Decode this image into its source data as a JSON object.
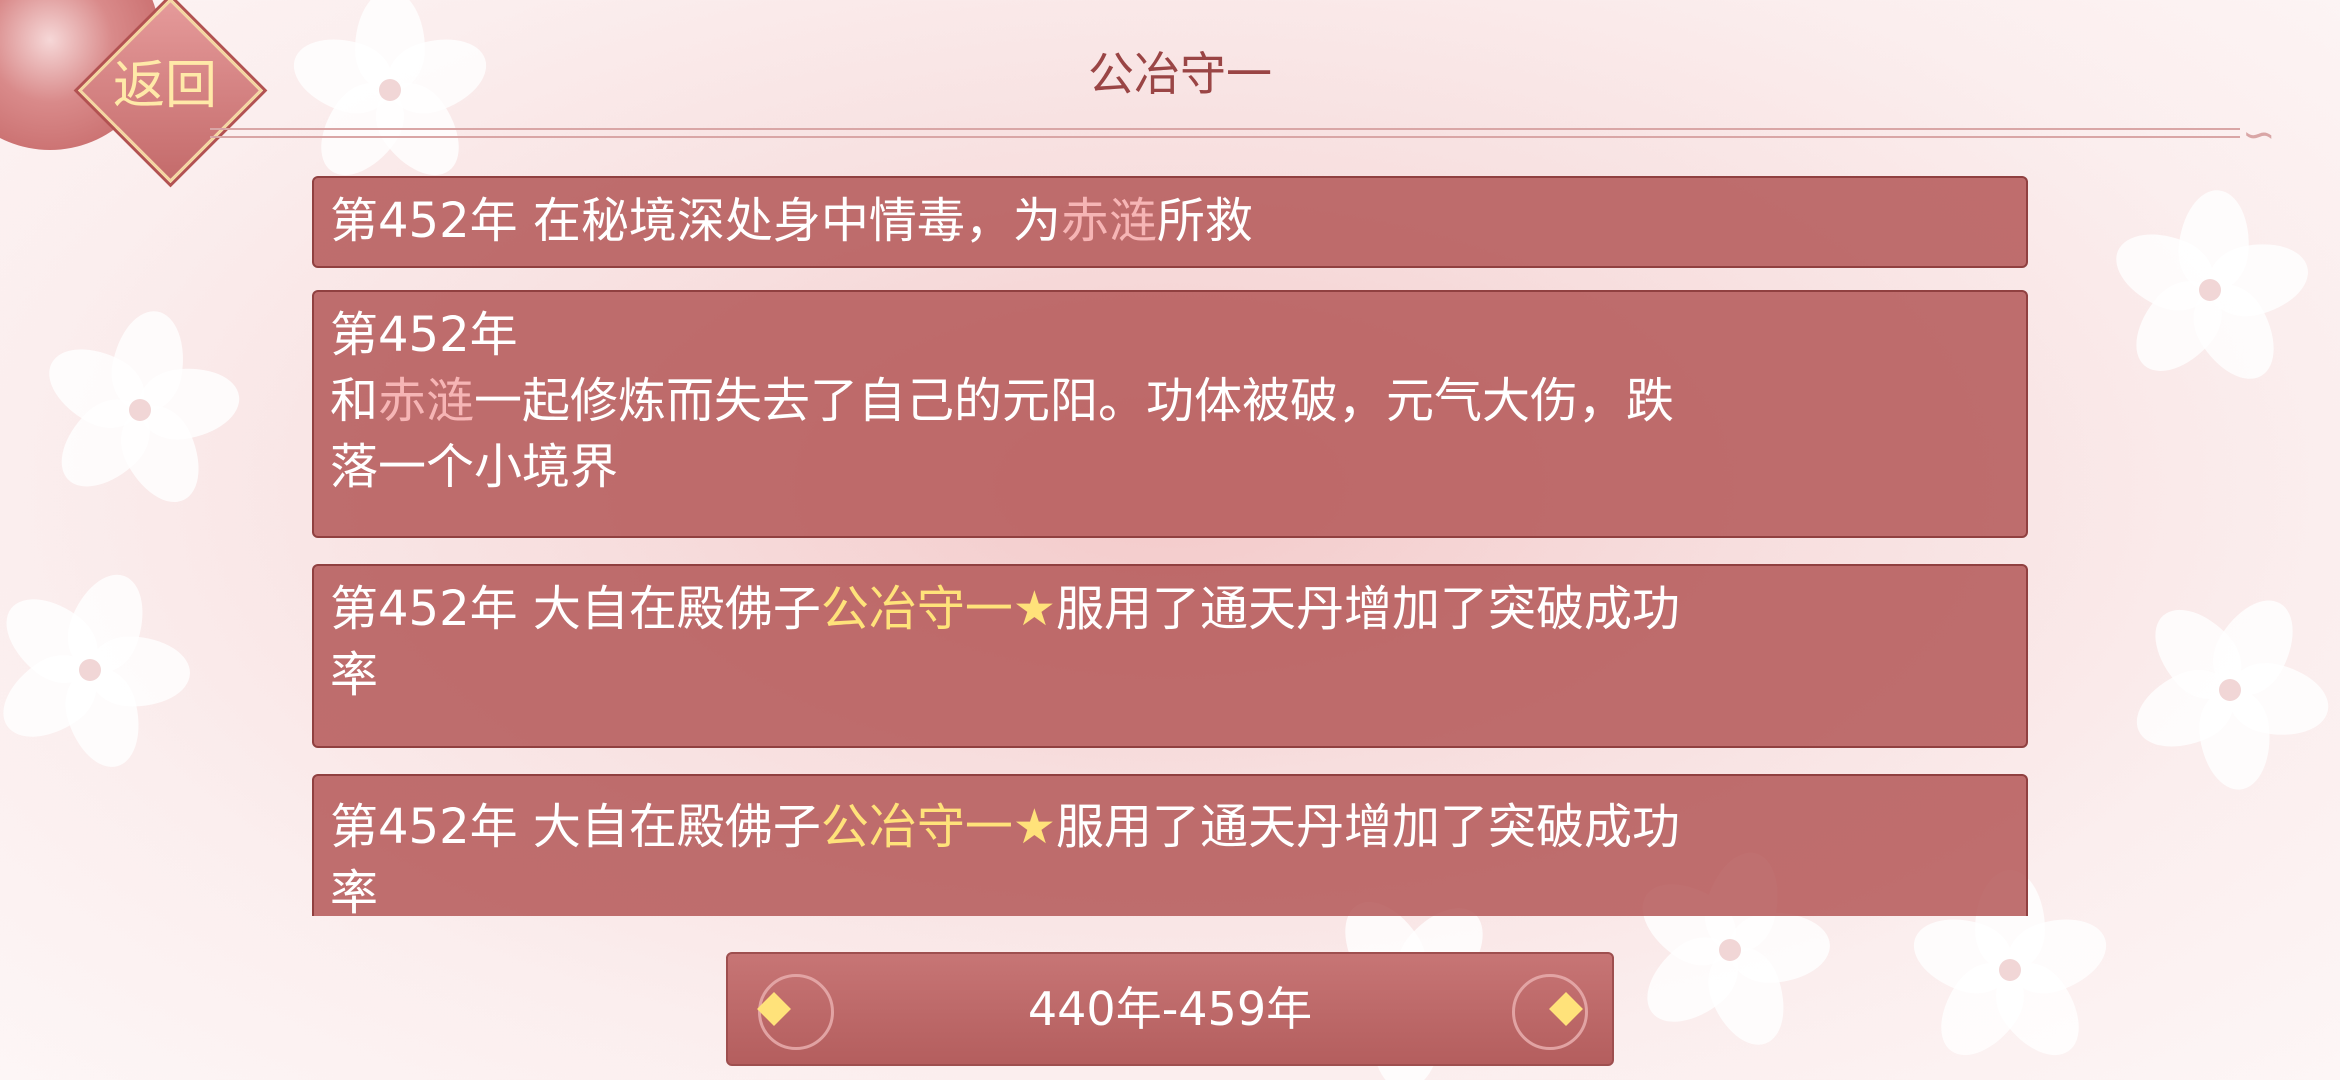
{
  "header": {
    "back_label": "返回",
    "title": "公冶守一"
  },
  "entries": [
    {
      "segments": [
        {
          "text": "第452年 在秘境深处身中情毒，为",
          "style": "normal"
        },
        {
          "text": "赤涟",
          "style": "pink"
        },
        {
          "text": "所救",
          "style": "normal"
        }
      ]
    },
    {
      "line1": "第452年",
      "segments": [
        {
          "text": "和",
          "style": "normal"
        },
        {
          "text": "赤涟",
          "style": "pink"
        },
        {
          "text": "一起修炼而失去了自己的元阳。功体被破，元气大伤，跌",
          "style": "normal"
        }
      ],
      "line3": "落一个小境界"
    },
    {
      "segments": [
        {
          "text": "第452年 大自在殿佛子",
          "style": "normal"
        },
        {
          "text": "公冶守一★",
          "style": "gold"
        },
        {
          "text": "服用了通天丹增加了突破成功",
          "style": "normal"
        }
      ],
      "line2": "率"
    },
    {
      "segments": [
        {
          "text": "第452年 大自在殿佛子",
          "style": "normal"
        },
        {
          "text": "公冶守一★",
          "style": "gold"
        },
        {
          "text": "服用了通天丹增加了突破成功",
          "style": "normal"
        }
      ],
      "line2": "率"
    }
  ],
  "pager": {
    "range_label": "440年-459年"
  },
  "colors": {
    "entry_bg": "#b45858",
    "highlight_pink": "#f6b5b5",
    "highlight_gold": "#ffe27a",
    "title": "#9a4545"
  }
}
